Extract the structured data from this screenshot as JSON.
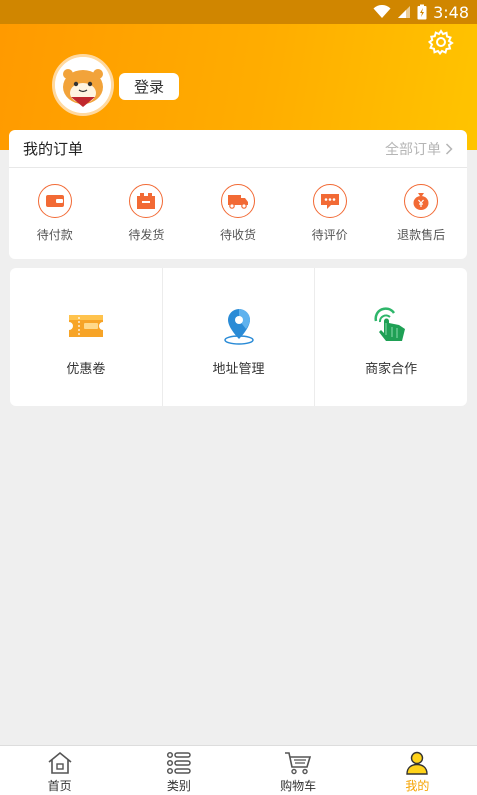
{
  "status_bar": {
    "time": "3:48"
  },
  "header": {
    "login_label": "登录",
    "settings_icon": "gear-icon"
  },
  "orders": {
    "title": "我的订单",
    "all_label": "全部订单",
    "items": [
      {
        "label": "待付款",
        "icon": "wallet-icon"
      },
      {
        "label": "待发货",
        "icon": "package-icon"
      },
      {
        "label": "待收货",
        "icon": "truck-icon"
      },
      {
        "label": "待评价",
        "icon": "comment-icon"
      },
      {
        "label": "退款售后",
        "icon": "money-bag-icon"
      }
    ]
  },
  "services": [
    {
      "label": "优惠卷",
      "icon": "coupon-icon"
    },
    {
      "label": "地址管理",
      "icon": "location-pin-icon"
    },
    {
      "label": "商家合作",
      "icon": "touch-hand-icon"
    }
  ],
  "bottom_nav": [
    {
      "label": "首页",
      "icon": "home-icon"
    },
    {
      "label": "类别",
      "icon": "list-icon"
    },
    {
      "label": "购物车",
      "icon": "cart-icon"
    },
    {
      "label": "我的",
      "icon": "user-icon",
      "active": true
    }
  ],
  "colors": {
    "accent": "#ff9a00",
    "order_icon": "#f26a35",
    "active_tab": "#f5a300"
  }
}
